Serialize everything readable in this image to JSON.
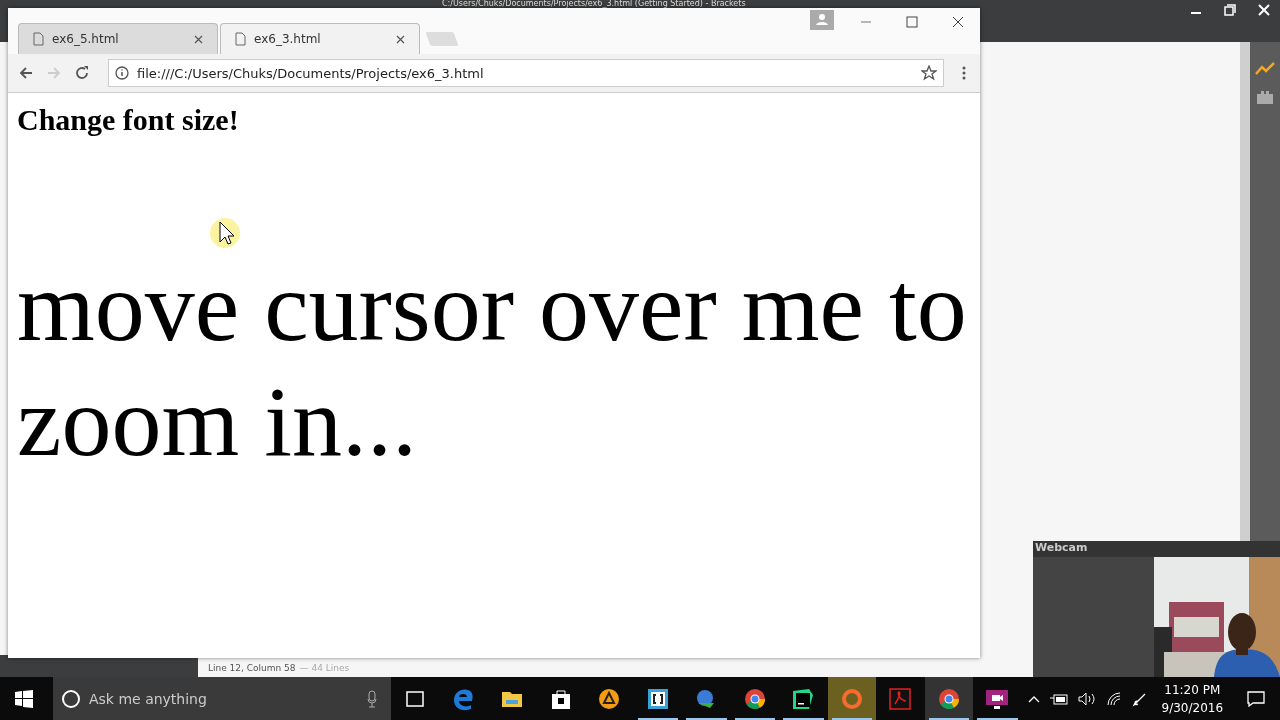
{
  "editor": {
    "title": "C:/Users/Chuks/Documents/Projects/ex6_3.html (Getting Started) - Brackets",
    "status": "Line 12, Column 58",
    "status_extra": "— 44 Lines"
  },
  "browser": {
    "tabs": [
      {
        "label": "ex6_5.html",
        "selected": false
      },
      {
        "label": "ex6_3.html",
        "selected": true
      }
    ],
    "url": "file:///C:/Users/Chuks/Documents/Projects/ex6_3.html",
    "page": {
      "heading": "Change font size!",
      "zoom_text": "move cursor over me to zoom in..."
    }
  },
  "webcam": {
    "title": "Webcam",
    "kind": "picture"
  },
  "taskbar": {
    "search": {
      "placeholder": "Ask me anything"
    },
    "apps": [
      {
        "kind": "taskview",
        "running": false,
        "active": false
      },
      {
        "kind": "edge",
        "running": false,
        "active": false
      },
      {
        "kind": "explorer",
        "running": false,
        "active": false
      },
      {
        "kind": "store",
        "running": false,
        "active": false
      },
      {
        "kind": "player",
        "running": false,
        "active": false
      },
      {
        "kind": "brackets",
        "running": true,
        "active": false
      },
      {
        "kind": "download",
        "running": true,
        "active": false
      },
      {
        "kind": "chrome",
        "running": true,
        "active": false
      },
      {
        "kind": "ide",
        "running": true,
        "active": false
      },
      {
        "kind": "origin",
        "running": true,
        "active": true
      },
      {
        "kind": "pdf",
        "running": false,
        "active": false
      },
      {
        "kind": "chrome",
        "running": true,
        "active": true
      },
      {
        "kind": "video",
        "running": true,
        "active": false
      }
    ],
    "time": "11:20 PM",
    "date": "9/30/2016"
  }
}
